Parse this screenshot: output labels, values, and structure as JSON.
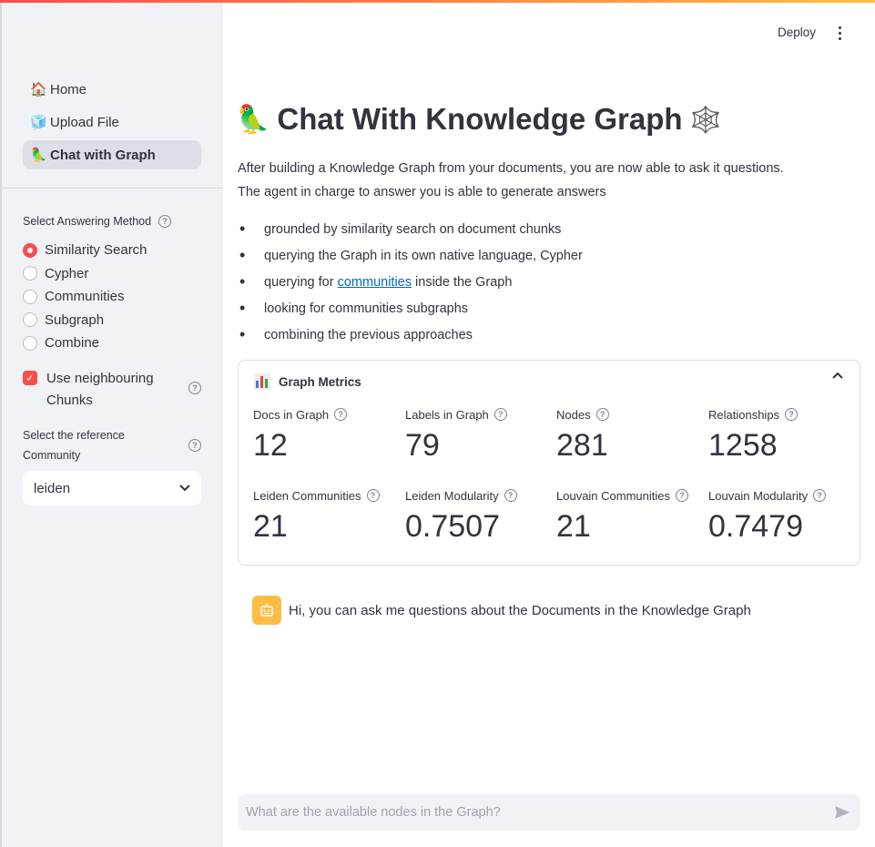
{
  "header": {
    "deploy_label": "Deploy"
  },
  "sidebar": {
    "nav": [
      {
        "emoji": "🏠",
        "label": "Home"
      },
      {
        "emoji": "🧊",
        "label": "Upload File"
      },
      {
        "emoji": "🦜",
        "label": "Chat with Graph",
        "active": true
      }
    ],
    "answering_method_label": "Select Answering Method",
    "methods": [
      "Similarity Search",
      "Cypher",
      "Communities",
      "Subgraph",
      "Combine"
    ],
    "selected_method": "Similarity Search",
    "neighbour_checkbox_label": "Use neighbouring Chunks",
    "neighbour_checked": true,
    "community_label": "Select the reference Community",
    "community_value": "leiden"
  },
  "main": {
    "title_emoji": "🦜",
    "title": "Chat With Knowledge Graph",
    "title_emoji_after": "🕸️",
    "intro_line1": "After building a Knowledge Graph from your documents, you are now able to ask it questions.",
    "intro_line2": "The agent in charge to answer you is able to generate answers",
    "bullets": {
      "b0": "grounded by similarity search on document chunks",
      "b1": "querying the Graph in its own native language, Cypher",
      "b2_prefix": "querying for",
      "b2_link": "communities",
      "b2_suffix": "inside the Graph",
      "b3": "looking for communities subgraphs",
      "b4": "combining the previous approaches"
    },
    "metrics_title": "Graph Metrics",
    "metrics": [
      {
        "label": "Docs in Graph",
        "value": "12"
      },
      {
        "label": "Labels in Graph",
        "value": "79"
      },
      {
        "label": "Nodes",
        "value": "281"
      },
      {
        "label": "Relationships",
        "value": "1258"
      },
      {
        "label": "Leiden Communities",
        "value": "21"
      },
      {
        "label": "Leiden Modularity",
        "value": "0.7507"
      },
      {
        "label": "Louvain Communities",
        "value": "21"
      },
      {
        "label": "Louvain Modularity",
        "value": "0.7479"
      }
    ],
    "assistant_message": "Hi, you can ask me questions about the Documents in the Knowledge Graph",
    "chat_placeholder": "What are the available nodes in the Graph?"
  },
  "colors": {
    "accent": "#ff4b4b",
    "bot": "#ffbd45",
    "link": "#0068c9",
    "sidebar_bg": "#f0f2f6"
  }
}
